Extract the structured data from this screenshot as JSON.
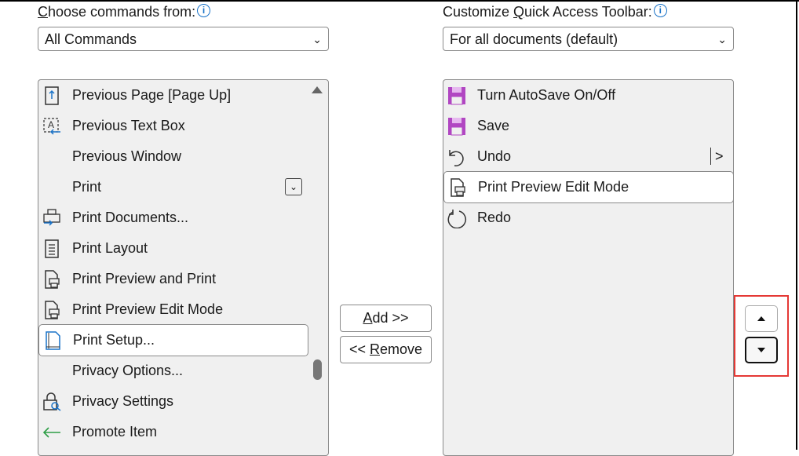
{
  "left": {
    "label_prefix": "C",
    "label_rest": "hoose commands from:",
    "dropdown": "All Commands",
    "items": [
      {
        "label": "Previous Page [Page Up]",
        "icon": "page-up-icon"
      },
      {
        "label": "Previous Text Box",
        "icon": "text-box-icon"
      },
      {
        "label": "Previous Window",
        "icon": ""
      },
      {
        "label": "Print",
        "icon": "",
        "dropdown": true
      },
      {
        "label": "Print Documents...",
        "icon": "print-documents-icon"
      },
      {
        "label": "Print Layout",
        "icon": "print-layout-icon"
      },
      {
        "label": "Print Preview and Print",
        "icon": "print-preview-icon"
      },
      {
        "label": "Print Preview Edit Mode",
        "icon": "print-preview-icon"
      },
      {
        "label": "Print Setup...",
        "icon": "print-setup-icon",
        "selected": true
      },
      {
        "label": "Privacy Options...",
        "icon": ""
      },
      {
        "label": "Privacy Settings",
        "icon": "privacy-lock-icon"
      },
      {
        "label": "Promote Item",
        "icon": "arrow-left-icon"
      }
    ]
  },
  "right": {
    "label_prefix": "Customize ",
    "label_u": "Q",
    "label_rest": "uick Access Toolbar:",
    "dropdown": "For all documents (default)",
    "items": [
      {
        "label": "Turn AutoSave On/Off",
        "icon": "save-icon"
      },
      {
        "label": "Save",
        "icon": "save-icon"
      },
      {
        "label": "Undo",
        "icon": "undo-icon",
        "submenu": true
      },
      {
        "label": "Print Preview Edit Mode",
        "icon": "print-preview-icon",
        "selected": true
      },
      {
        "label": "Redo",
        "icon": "redo-icon"
      }
    ]
  },
  "buttons": {
    "add_u": "A",
    "add_rest": "dd >>",
    "remove_pre": "<< ",
    "remove_u": "R",
    "remove_rest": "emove"
  },
  "colors": {
    "accent": "#1a73c8",
    "save": "#b146c2",
    "highlight": "#e53935",
    "promote": "#2e9e46"
  }
}
